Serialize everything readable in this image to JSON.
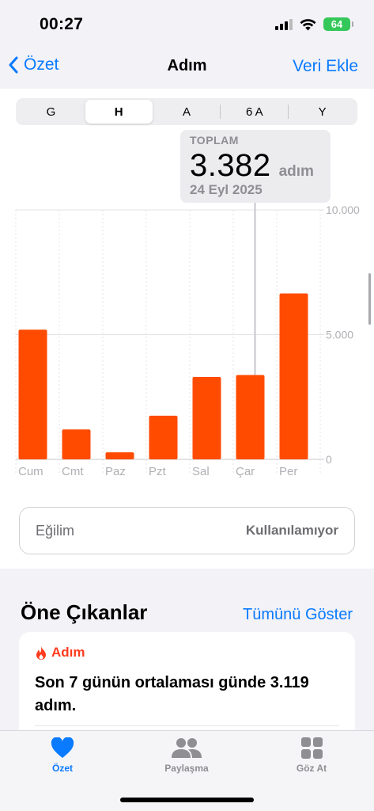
{
  "status_bar": {
    "time": "00:27",
    "battery": "64"
  },
  "nav": {
    "back_label": "Özet",
    "title": "Adım",
    "action_label": "Veri Ekle"
  },
  "segments": [
    {
      "label": "G",
      "active": false
    },
    {
      "label": "H",
      "active": true
    },
    {
      "label": "A",
      "active": false
    },
    {
      "label": "6 A",
      "active": false
    },
    {
      "label": "Y",
      "active": false
    }
  ],
  "tooltip": {
    "label": "TOPLAM",
    "value": "3.382",
    "unit": "adım",
    "date": "24 Eyl 2025"
  },
  "chart_data": {
    "type": "bar",
    "categories": [
      "Cum",
      "Cmt",
      "Paz",
      "Pzt",
      "Sal",
      "Çar",
      "Per"
    ],
    "values": [
      5200,
      1200,
      280,
      1750,
      3300,
      3382,
      6650
    ],
    "ylim": [
      0,
      10000
    ],
    "y_ticks": [
      0,
      5000,
      10000
    ],
    "y_tick_labels": [
      "0",
      "5.000",
      "10.000"
    ],
    "selected_index": 5,
    "bar_color": "#ff4b00",
    "grid": true
  },
  "trend": {
    "label": "Eğilim",
    "value": "Kullanılamıyor"
  },
  "highlights": {
    "title": "Öne Çıkanlar",
    "link": "Tümünü Göster",
    "card": {
      "category": "Adım",
      "text": "Son 7 günün ortalaması günde 3.119 adım."
    }
  },
  "tabbar": [
    {
      "label": "Özet",
      "icon": "heart-icon",
      "active": true
    },
    {
      "label": "Paylaşma",
      "icon": "people-icon",
      "active": false
    },
    {
      "label": "Göz At",
      "icon": "grid-icon",
      "active": false
    }
  ],
  "colors": {
    "accent": "#0a7aff",
    "bar": "#ff4b00",
    "flame": "#ff3b1f"
  }
}
